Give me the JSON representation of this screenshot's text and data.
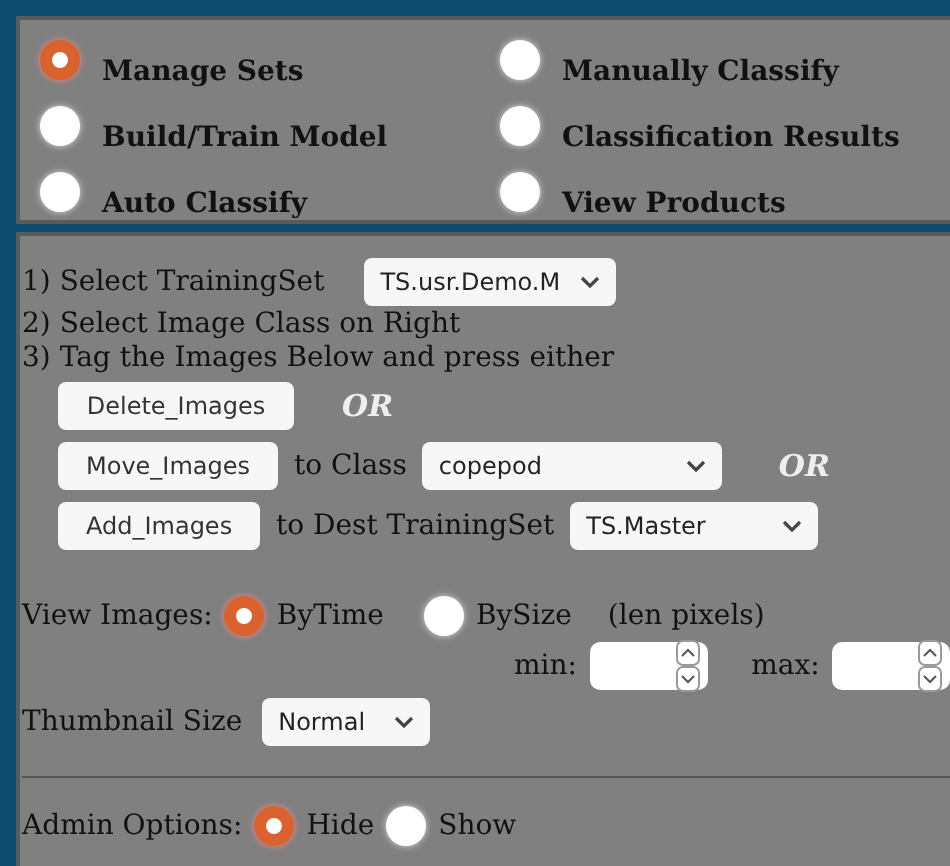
{
  "modes": [
    {
      "label": "Manage Sets",
      "selected": true
    },
    {
      "label": "Manually Classify",
      "selected": false
    },
    {
      "label": "Build/Train Model",
      "selected": false
    },
    {
      "label": "Classification Results",
      "selected": false
    },
    {
      "label": "Auto Classify",
      "selected": false
    },
    {
      "label": "View Products",
      "selected": false
    }
  ],
  "steps": {
    "select_training_set": {
      "label": "1) Select TrainingSet",
      "value": "TS.usr.Demo.M"
    },
    "step_2": "2) Select Image Class on Right",
    "step_3": "3) Tag the Images Below and press either",
    "delete": {
      "button": "Delete_Images",
      "or": "OR"
    },
    "move": {
      "button": "Move_Images",
      "text": "to Class",
      "value": "copepod",
      "or": "OR"
    },
    "add": {
      "button": "Add_Images",
      "text": "to Dest TrainingSet",
      "value": "TS.Master"
    }
  },
  "view_images": {
    "label": "View Images:",
    "options": [
      {
        "label": "ByTime",
        "selected": true
      },
      {
        "label": "BySize",
        "selected": false
      }
    ],
    "note": "(len pixels)",
    "min_label": "min:",
    "max_label": "max:"
  },
  "thumbnail_size": {
    "label": "Thumbnail Size",
    "value": "Normal"
  },
  "admin_options": {
    "label": "Admin Options:",
    "options": [
      {
        "label": "Hide",
        "selected": true
      },
      {
        "label": "Show",
        "selected": false
      }
    ]
  }
}
